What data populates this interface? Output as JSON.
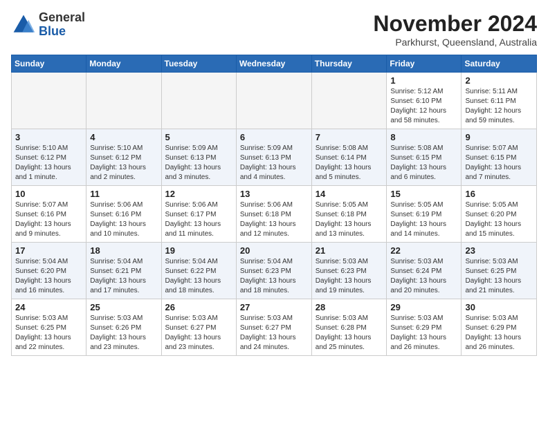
{
  "header": {
    "logo_general": "General",
    "logo_blue": "Blue",
    "month": "November 2024",
    "location": "Parkhurst, Queensland, Australia"
  },
  "weekdays": [
    "Sunday",
    "Monday",
    "Tuesday",
    "Wednesday",
    "Thursday",
    "Friday",
    "Saturday"
  ],
  "weeks": [
    [
      {
        "day": "",
        "info": ""
      },
      {
        "day": "",
        "info": ""
      },
      {
        "day": "",
        "info": ""
      },
      {
        "day": "",
        "info": ""
      },
      {
        "day": "",
        "info": ""
      },
      {
        "day": "1",
        "info": "Sunrise: 5:12 AM\nSunset: 6:10 PM\nDaylight: 12 hours\nand 58 minutes."
      },
      {
        "day": "2",
        "info": "Sunrise: 5:11 AM\nSunset: 6:11 PM\nDaylight: 12 hours\nand 59 minutes."
      }
    ],
    [
      {
        "day": "3",
        "info": "Sunrise: 5:10 AM\nSunset: 6:12 PM\nDaylight: 13 hours\nand 1 minute."
      },
      {
        "day": "4",
        "info": "Sunrise: 5:10 AM\nSunset: 6:12 PM\nDaylight: 13 hours\nand 2 minutes."
      },
      {
        "day": "5",
        "info": "Sunrise: 5:09 AM\nSunset: 6:13 PM\nDaylight: 13 hours\nand 3 minutes."
      },
      {
        "day": "6",
        "info": "Sunrise: 5:09 AM\nSunset: 6:13 PM\nDaylight: 13 hours\nand 4 minutes."
      },
      {
        "day": "7",
        "info": "Sunrise: 5:08 AM\nSunset: 6:14 PM\nDaylight: 13 hours\nand 5 minutes."
      },
      {
        "day": "8",
        "info": "Sunrise: 5:08 AM\nSunset: 6:15 PM\nDaylight: 13 hours\nand 6 minutes."
      },
      {
        "day": "9",
        "info": "Sunrise: 5:07 AM\nSunset: 6:15 PM\nDaylight: 13 hours\nand 7 minutes."
      }
    ],
    [
      {
        "day": "10",
        "info": "Sunrise: 5:07 AM\nSunset: 6:16 PM\nDaylight: 13 hours\nand 9 minutes."
      },
      {
        "day": "11",
        "info": "Sunrise: 5:06 AM\nSunset: 6:16 PM\nDaylight: 13 hours\nand 10 minutes."
      },
      {
        "day": "12",
        "info": "Sunrise: 5:06 AM\nSunset: 6:17 PM\nDaylight: 13 hours\nand 11 minutes."
      },
      {
        "day": "13",
        "info": "Sunrise: 5:06 AM\nSunset: 6:18 PM\nDaylight: 13 hours\nand 12 minutes."
      },
      {
        "day": "14",
        "info": "Sunrise: 5:05 AM\nSunset: 6:18 PM\nDaylight: 13 hours\nand 13 minutes."
      },
      {
        "day": "15",
        "info": "Sunrise: 5:05 AM\nSunset: 6:19 PM\nDaylight: 13 hours\nand 14 minutes."
      },
      {
        "day": "16",
        "info": "Sunrise: 5:05 AM\nSunset: 6:20 PM\nDaylight: 13 hours\nand 15 minutes."
      }
    ],
    [
      {
        "day": "17",
        "info": "Sunrise: 5:04 AM\nSunset: 6:20 PM\nDaylight: 13 hours\nand 16 minutes."
      },
      {
        "day": "18",
        "info": "Sunrise: 5:04 AM\nSunset: 6:21 PM\nDaylight: 13 hours\nand 17 minutes."
      },
      {
        "day": "19",
        "info": "Sunrise: 5:04 AM\nSunset: 6:22 PM\nDaylight: 13 hours\nand 18 minutes."
      },
      {
        "day": "20",
        "info": "Sunrise: 5:04 AM\nSunset: 6:23 PM\nDaylight: 13 hours\nand 18 minutes."
      },
      {
        "day": "21",
        "info": "Sunrise: 5:03 AM\nSunset: 6:23 PM\nDaylight: 13 hours\nand 19 minutes."
      },
      {
        "day": "22",
        "info": "Sunrise: 5:03 AM\nSunset: 6:24 PM\nDaylight: 13 hours\nand 20 minutes."
      },
      {
        "day": "23",
        "info": "Sunrise: 5:03 AM\nSunset: 6:25 PM\nDaylight: 13 hours\nand 21 minutes."
      }
    ],
    [
      {
        "day": "24",
        "info": "Sunrise: 5:03 AM\nSunset: 6:25 PM\nDaylight: 13 hours\nand 22 minutes."
      },
      {
        "day": "25",
        "info": "Sunrise: 5:03 AM\nSunset: 6:26 PM\nDaylight: 13 hours\nand 23 minutes."
      },
      {
        "day": "26",
        "info": "Sunrise: 5:03 AM\nSunset: 6:27 PM\nDaylight: 13 hours\nand 23 minutes."
      },
      {
        "day": "27",
        "info": "Sunrise: 5:03 AM\nSunset: 6:27 PM\nDaylight: 13 hours\nand 24 minutes."
      },
      {
        "day": "28",
        "info": "Sunrise: 5:03 AM\nSunset: 6:28 PM\nDaylight: 13 hours\nand 25 minutes."
      },
      {
        "day": "29",
        "info": "Sunrise: 5:03 AM\nSunset: 6:29 PM\nDaylight: 13 hours\nand 26 minutes."
      },
      {
        "day": "30",
        "info": "Sunrise: 5:03 AM\nSunset: 6:29 PM\nDaylight: 13 hours\nand 26 minutes."
      }
    ]
  ]
}
